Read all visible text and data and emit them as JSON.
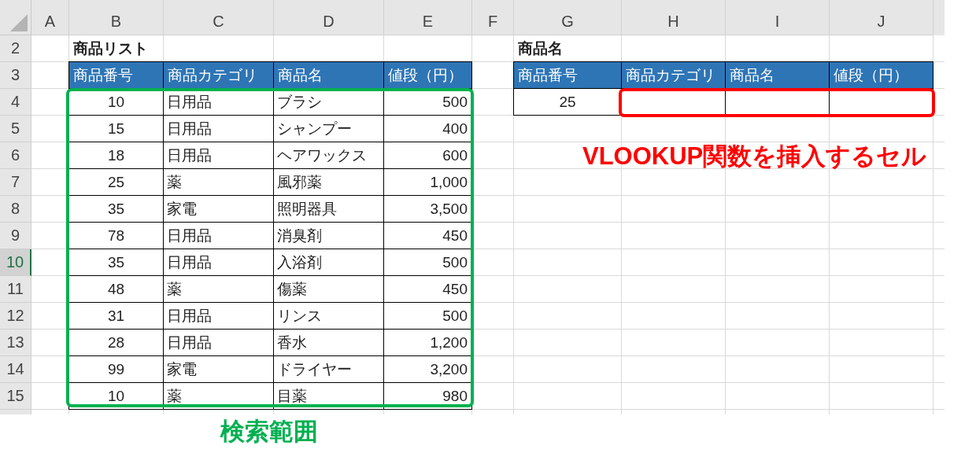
{
  "sheet": {
    "columns": [
      {
        "label": "A",
        "selected": false
      },
      {
        "label": "B",
        "selected": false
      },
      {
        "label": "C",
        "selected": false
      },
      {
        "label": "D",
        "selected": false
      },
      {
        "label": "E",
        "selected": false
      },
      {
        "label": "F",
        "selected": false
      },
      {
        "label": "G",
        "selected": false
      },
      {
        "label": "H",
        "selected": false
      },
      {
        "label": "I",
        "selected": false
      },
      {
        "label": "J",
        "selected": false
      }
    ],
    "rows": [
      {
        "label": "2",
        "selected": false
      },
      {
        "label": "3",
        "selected": false
      },
      {
        "label": "4",
        "selected": false
      },
      {
        "label": "5",
        "selected": false
      },
      {
        "label": "6",
        "selected": false
      },
      {
        "label": "7",
        "selected": false
      },
      {
        "label": "8",
        "selected": false
      },
      {
        "label": "9",
        "selected": false
      },
      {
        "label": "10",
        "selected": true
      },
      {
        "label": "11",
        "selected": false
      },
      {
        "label": "12",
        "selected": false
      },
      {
        "label": "13",
        "selected": false
      },
      {
        "label": "14",
        "selected": false
      },
      {
        "label": "15",
        "selected": false
      }
    ]
  },
  "product_list": {
    "title": "商品リスト",
    "columns": [
      {
        "label": "商品番号",
        "kind": "id"
      },
      {
        "label": "商品カテゴリ",
        "kind": "text"
      },
      {
        "label": "商品名",
        "kind": "text"
      },
      {
        "label": "値段（円）",
        "kind": "amount"
      }
    ],
    "rows": [
      [
        "10",
        "日用品",
        "ブラシ",
        "500"
      ],
      [
        "15",
        "日用品",
        "シャンプー",
        "400"
      ],
      [
        "18",
        "日用品",
        "ヘアワックス",
        "600"
      ],
      [
        "25",
        "薬",
        "風邪薬",
        "1,000"
      ],
      [
        "35",
        "家電",
        "照明器具",
        "3,500"
      ],
      [
        "78",
        "日用品",
        "消臭剤",
        "450"
      ],
      [
        "35",
        "日用品",
        "入浴剤",
        "500"
      ],
      [
        "48",
        "薬",
        "傷薬",
        "450"
      ],
      [
        "31",
        "日用品",
        "リンス",
        "500"
      ],
      [
        "28",
        "日用品",
        "香水",
        "1,200"
      ],
      [
        "99",
        "家電",
        "ドライヤー",
        "3,200"
      ],
      [
        "10",
        "薬",
        "目薬",
        "980"
      ]
    ]
  },
  "lookup_table": {
    "title": "商品名",
    "columns": [
      {
        "label": "商品番号",
        "kind": "id"
      },
      {
        "label": "商品カテゴリ",
        "kind": "text"
      },
      {
        "label": "商品名",
        "kind": "text"
      },
      {
        "label": "値段（円）",
        "kind": "amount"
      }
    ],
    "rows": [
      [
        "25"
      ]
    ]
  },
  "annotations": [
    {
      "kind": "range",
      "label": "検索範囲",
      "color": "#00b050"
    },
    {
      "kind": "range",
      "label": "VLOOKUP関数を挿入するセル",
      "color": "#ff0000"
    }
  ]
}
